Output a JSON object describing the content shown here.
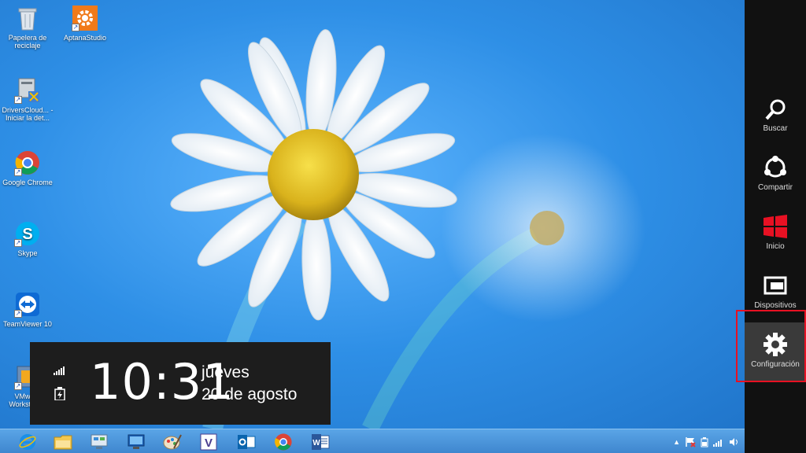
{
  "desktop": {
    "icons": [
      {
        "label": "Papelera de reciclaje",
        "icon": "recycle-bin-icon"
      },
      {
        "label": "AptanaStudio",
        "icon": "aptana-icon"
      },
      {
        "label": "DriversCloud... - Iniciar la det...",
        "icon": "driverscloud-icon"
      },
      {
        "label": "Google Chrome",
        "icon": "chrome-icon"
      },
      {
        "label": "Skype",
        "icon": "skype-icon"
      },
      {
        "label": "TeamViewer 10",
        "icon": "teamviewer-icon"
      },
      {
        "label": "VMware Workstation",
        "icon": "vmware-icon"
      }
    ]
  },
  "clock": {
    "time": "10:31",
    "day": "jueves",
    "date": "20 de agosto"
  },
  "taskbar": {
    "items": [
      "internet-explorer-icon",
      "file-explorer-icon",
      "network-icon",
      "remote-desktop-icon",
      "paint-icon",
      "visual-studio-icon",
      "outlook-icon",
      "chrome-icon",
      "word-icon"
    ]
  },
  "charms": {
    "items": [
      {
        "label": "Buscar",
        "icon": "search-icon"
      },
      {
        "label": "Compartir",
        "icon": "share-icon"
      },
      {
        "label": "Inicio",
        "icon": "windows-logo-icon"
      },
      {
        "label": "Dispositivos",
        "icon": "devices-icon"
      },
      {
        "label": "Configuración",
        "icon": "gear-icon"
      }
    ],
    "selected": "Configuración",
    "accent": "#e81123"
  }
}
